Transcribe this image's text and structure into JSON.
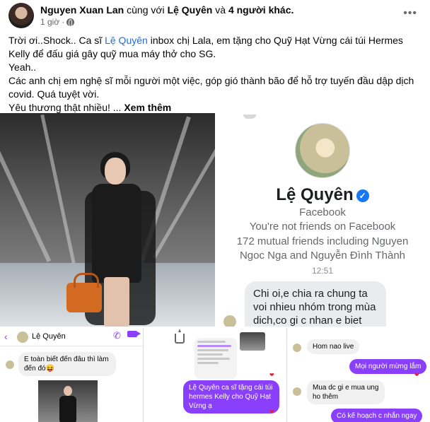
{
  "header": {
    "author": "Nguyen Xuan Lan",
    "with_text": "cùng với",
    "tagged": "Lệ Quyên",
    "and_text": "và",
    "others": "4 người khác.",
    "time": "1 giờ",
    "time_separator": "·",
    "more_icon": "more-horizontal-icon",
    "more_glyph": "•••"
  },
  "post": {
    "line1_prefix": "Trời ơi..Shock.. Ca sĩ",
    "line1_mention": "Lệ Quyên",
    "line1_suffix": "inbox chị Lala, em tặng cho Quỹ Hạt Vừng cái túi Hermes Kelly để đấu giá gây quỹ mua máy thở cho SG.",
    "line2": "Yeah..",
    "line3": "Các anh chị em nghệ sĩ mỗi người một việc, góp gió thành bão để hỗ trợ tuyến đầu dập dịch covid. Quá tuyệt vời.",
    "line4": "Yêu thương thật nhiều! ...",
    "see_more": "Xem thêm"
  },
  "profile_card": {
    "name": "Lệ Quyên",
    "verified_glyph": "✓",
    "platform": "Facebook",
    "not_friends": "You're not friends on Facebook",
    "mutual": "172 mutual friends including Nguyen Ngoc Nga and Nguyễn Đình Thành",
    "time": "12:51",
    "message": "Chi oi,e chia ra chung ta voi nhieu nhóm trong mùa dich,co gi c nhan e biet nhe"
  },
  "chat_a": {
    "back_glyph": "‹",
    "contact": "Lệ Quyên",
    "phone_glyph": "✆",
    "message": "E toàn biết đến đâu thì làm đến đó😝"
  },
  "chat_b": {
    "message": "Lệ Quyên ca sĩ tặng cái túi hermes Kelly cho Quỹ Hạt Vừng ạ"
  },
  "chat_c": {
    "msg1": "Hom nao live",
    "msg2": "Mọi người mừng lắm",
    "msg3": "Mua dc gi e mua ung ho thêm",
    "msg4": "Có kế hoạch c nhắn ngay",
    "heart_glyph": "❤"
  },
  "colors": {
    "mention": "#216fdb",
    "messenger_purple": "#8a3ffc",
    "secondary_text": "#65676b"
  }
}
